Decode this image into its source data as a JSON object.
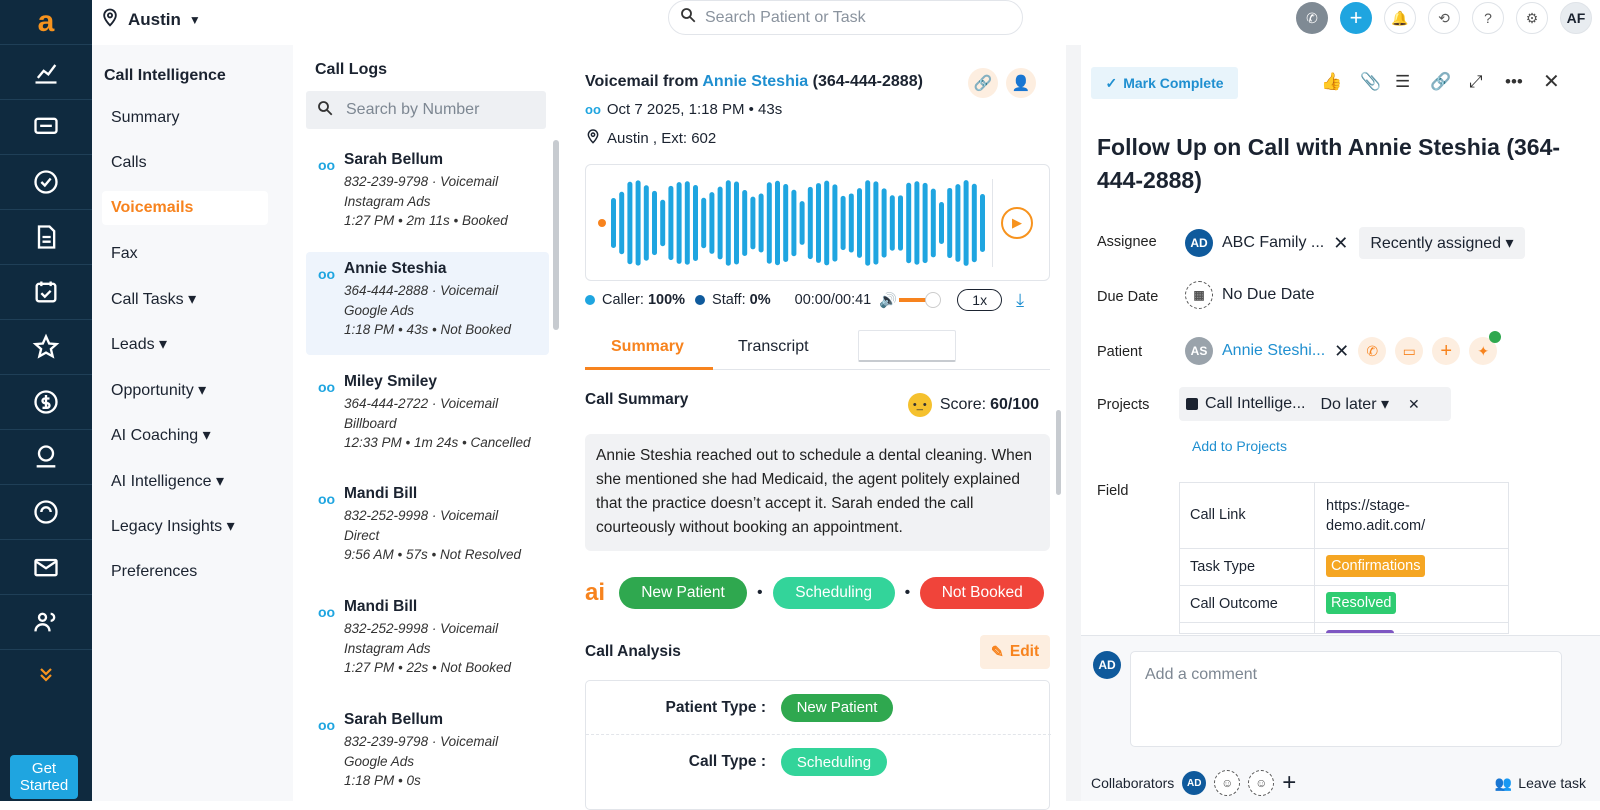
{
  "rail": {
    "logo": "a",
    "get_started": "Get Started"
  },
  "topbar": {
    "location": "Austin",
    "search_placeholder": "Search Patient or Task",
    "avatar": "AF"
  },
  "nav": {
    "title": "Call Intelligence",
    "items": [
      {
        "label": "Summary"
      },
      {
        "label": "Calls"
      },
      {
        "label": "Voicemails",
        "active": true
      },
      {
        "label": "Fax"
      },
      {
        "label": "Call Tasks ▾"
      },
      {
        "label": "Leads ▾"
      },
      {
        "label": "Opportunity ▾"
      },
      {
        "label": "AI Coaching ▾"
      },
      {
        "label": "AI Intelligence ▾"
      },
      {
        "label": "Legacy Insights ▾"
      },
      {
        "label": "Preferences"
      }
    ]
  },
  "call_logs": {
    "title": "Call Logs",
    "search_placeholder": "Search by Number",
    "items": [
      {
        "name": "Sarah Bellum",
        "line1": "832-239-9798 · Voicemail",
        "line2": "Instagram Ads",
        "line3": "1:27 PM  •  2m 11s  •  Booked"
      },
      {
        "name": "Annie Steshia",
        "line1": "364-444-2888 · Voicemail",
        "line2": "Google Ads",
        "line3": "1:18 PM  •  43s  •  Not Booked"
      },
      {
        "name": "Miley Smiley",
        "line1": "364-444-2722 · Voicemail",
        "line2": "Billboard",
        "line3": "12:33 PM  •  1m 24s  •  Cancelled"
      },
      {
        "name": "Mandi Bill",
        "line1": "832-252-9998 · Voicemail",
        "line2": "Direct",
        "line3": "9:56 AM  •  57s  •  Not Resolved"
      },
      {
        "name": "Mandi Bill",
        "line1": "832-252-9998 · Voicemail",
        "line2": "Instagram Ads",
        "line3": "1:27 PM  •  22s  •  Not Booked"
      },
      {
        "name": "Sarah Bellum",
        "line1": "832-239-9798 · Voicemail",
        "line2": "Google Ads",
        "line3": "1:18 PM  •  0s"
      }
    ]
  },
  "detail": {
    "heading_prefix": "Voicemail from ",
    "caller_name": "Annie Steshia",
    "caller_phone": " (364-444-2888)",
    "datetime": "Oct 7 2025, 1:18 PM • 43s",
    "location": "Austin , Ext: 602",
    "caller_label": "Caller:",
    "caller_pct": "100%",
    "staff_label": "Staff:",
    "staff_pct": "0%",
    "time": "00:00/00:41",
    "speed": "1x",
    "volume_level": 0.85,
    "tabs": [
      "Summary",
      "Transcript"
    ],
    "summary_title": "Call Summary",
    "score_label": "Score:",
    "score": "60/100",
    "summary_text": "Annie Steshia reached out to schedule a dental cleaning. When she mentioned she had Medicaid, the agent politely explained that the practice doesn’t accept it. Sarah ended the call courteously without booking an appointment.",
    "ai_label": "ai",
    "tags": [
      {
        "label": "New Patient",
        "color": "#2fa84f"
      },
      {
        "label": "Scheduling",
        "color": "#33d49a"
      },
      {
        "label": "Not Booked",
        "color": "#f0443a"
      }
    ],
    "analysis_title": "Call Analysis",
    "edit_label": "Edit",
    "analysis": [
      {
        "key": "Patient Type :",
        "value": "New Patient",
        "color": "#2fa84f"
      },
      {
        "key": "Call Type :",
        "value": "Scheduling",
        "color": "#33d49a"
      }
    ]
  },
  "task": {
    "mark_complete": "Mark Complete",
    "title": "Follow Up on Call with Annie Steshia (364-444-2888)",
    "assignee_label": "Assignee",
    "assignee_avatar": "AD",
    "assignee_name": "ABC Family ...",
    "recently_assigned": "Recently assigned ▾",
    "due_label": "Due Date",
    "due_value": "No Due Date",
    "patient_label": "Patient",
    "patient_avatar": "AS",
    "patient_name": "Annie Steshi...",
    "projects_label": "Projects",
    "project_name": "Call Intellige...",
    "project_status": "Do later ▾",
    "add_projects": "Add to Projects",
    "field_label": "Field",
    "fields": [
      {
        "key": "Call Link",
        "value": "https://stage-demo.adit.com/"
      },
      {
        "key": "Task Type",
        "value": "Confirmations",
        "color": "#f5a623"
      },
      {
        "key": "Call Outcome",
        "value": "Resolved",
        "color": "#2ecc71"
      }
    ],
    "comment_avatar": "AD",
    "comment_placeholder": "Add a comment",
    "collaborators_label": "Collaborators",
    "collab_avatar": "AD",
    "leave_task": "Leave task"
  },
  "colors": {
    "accent": "#f7831e",
    "link": "#1f8fd0",
    "rail": "#0f2a3f",
    "wave": "#1fa5e0"
  }
}
